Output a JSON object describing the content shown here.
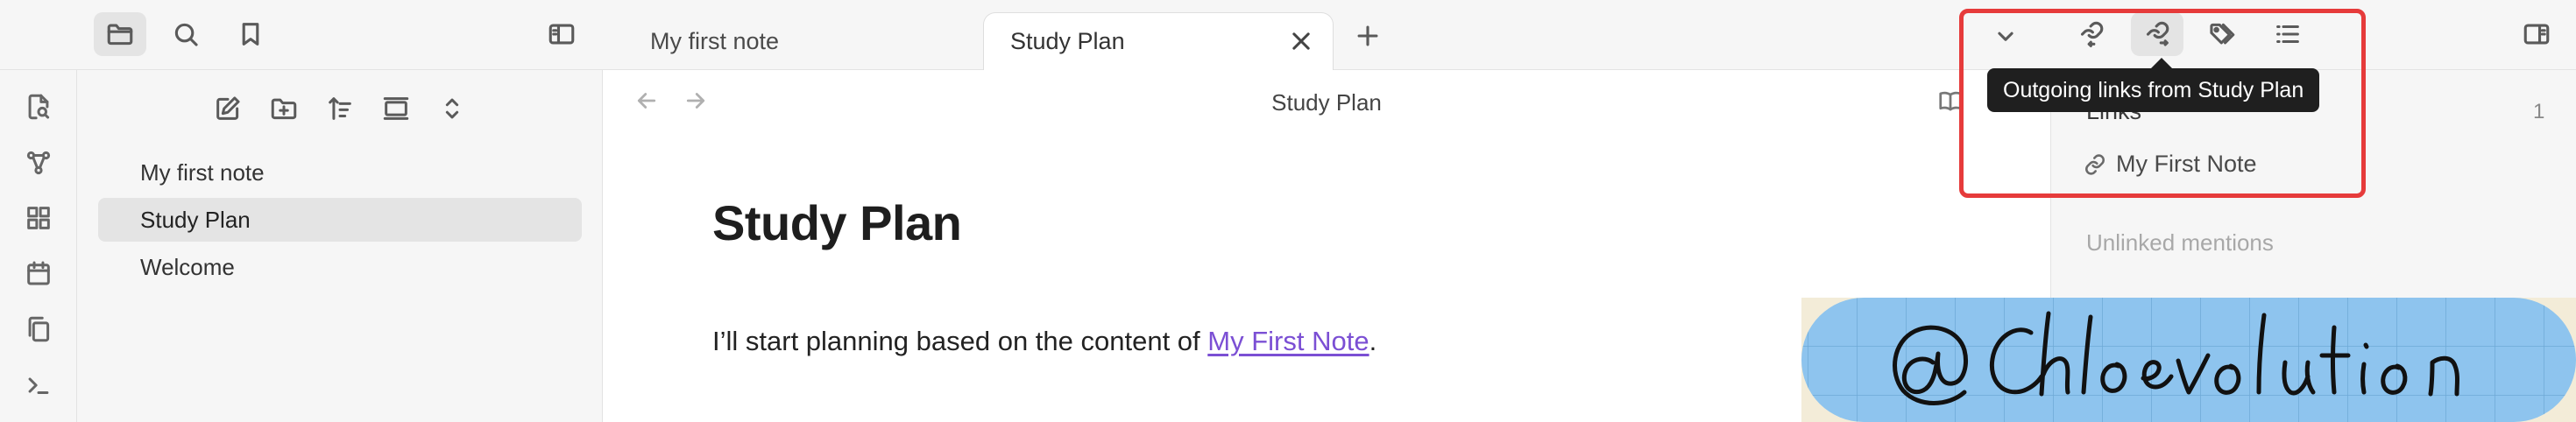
{
  "tabs": [
    {
      "label": "My first note"
    },
    {
      "label": "Study Plan"
    }
  ],
  "editor": {
    "view_title": "Study Plan",
    "heading": "Study Plan",
    "paragraph_prefix": "I’ll start planning based on the content of ",
    "paragraph_link": "My First Note",
    "paragraph_suffix": "."
  },
  "explorer": {
    "files": [
      {
        "label": "My first note"
      },
      {
        "label": "Study Plan"
      },
      {
        "label": "Welcome"
      }
    ]
  },
  "right_sidebar": {
    "tooltip": "Outgoing links from Study Plan",
    "links_heading": "Links",
    "links_count": "1",
    "links": [
      {
        "label": "My First Note"
      }
    ],
    "unlinked_heading": "Unlinked mentions"
  },
  "watermark": {
    "text": "@ Chloevolution"
  },
  "colors": {
    "accent_link": "#7b4fd4",
    "highlight_box": "#e63b3b",
    "watermark_bg": "#8ec4ee"
  }
}
